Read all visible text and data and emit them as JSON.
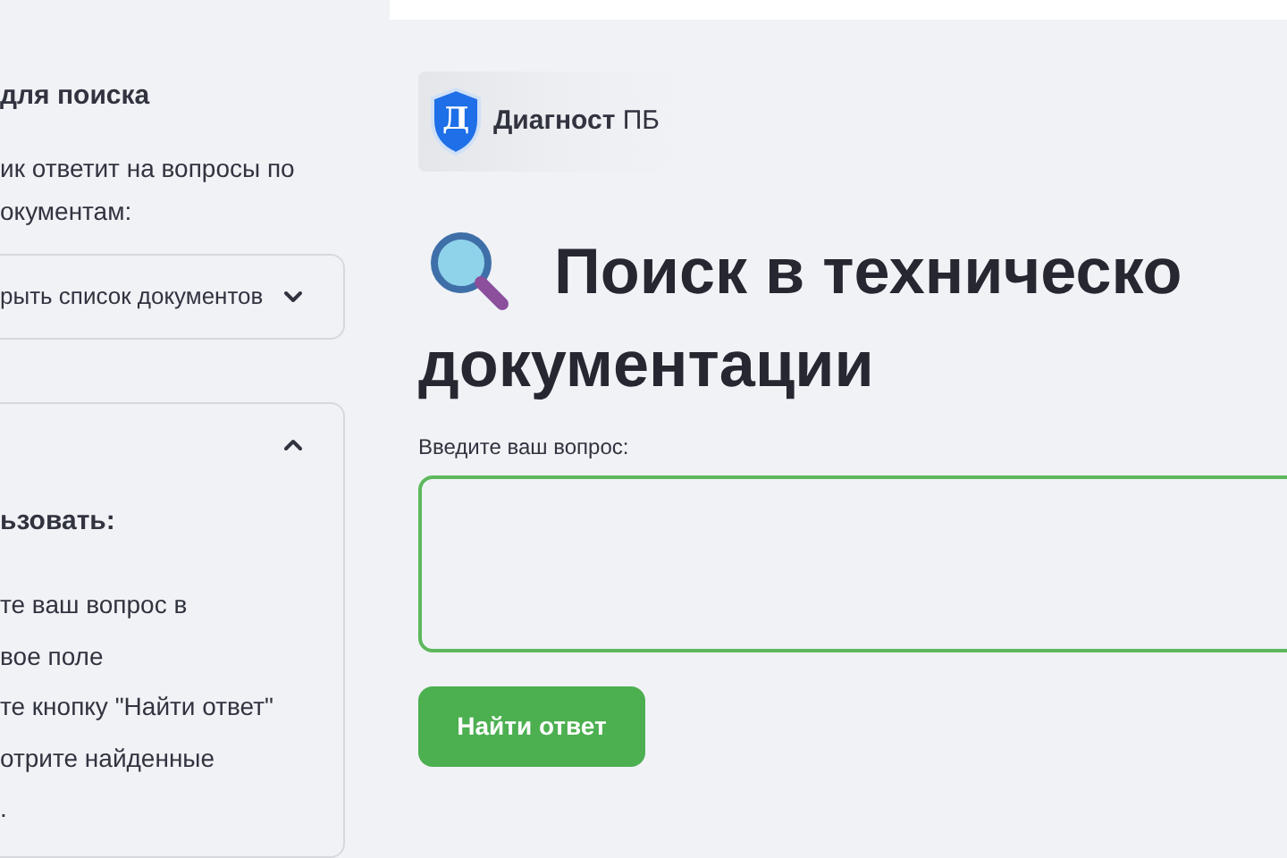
{
  "sidebar": {
    "heading": "для поиска",
    "intro_lines": [
      "ик ответит на вопросы по",
      "окументам:"
    ],
    "expanders": [
      {
        "label": "рыть список документов",
        "expanded": false
      },
      {
        "expanded": true,
        "heading": "ьзовать:",
        "lines": [
          "те ваш вопрос в",
          "вое поле",
          "те кнопку \"Найти ответ\"",
          "отрите найденные",
          "."
        ]
      }
    ]
  },
  "logo": {
    "letter": "Д",
    "name": "Диагност",
    "suffix": "ПБ"
  },
  "title_lines": [
    "Поиск в техническо",
    "документации"
  ],
  "question": {
    "label": "Введите ваш вопрос:"
  },
  "submit": {
    "label": "Найти ответ"
  }
}
